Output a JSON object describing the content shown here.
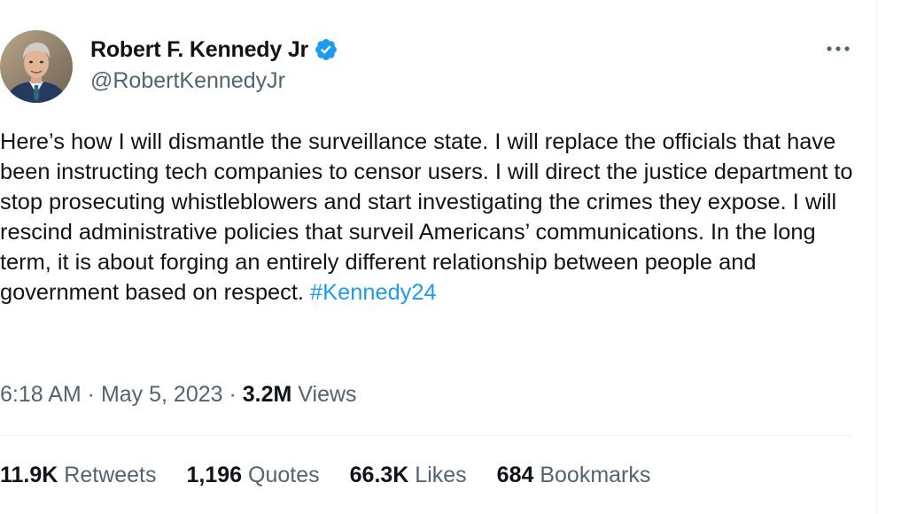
{
  "tweet": {
    "author": {
      "display_name": "Robert F. Kennedy Jr",
      "handle": "@RobertKennedyJr",
      "verified": true,
      "avatar_icon": "profile-photo"
    },
    "body_text": "Here’s how I will dismantle the surveillance state. I will replace the officials that have been instructing tech companies to censor users. I will direct the justice department to stop prosecuting whistleblowers and start investigating the crimes they expose. I will rescind administrative policies that surveil Americans’ communications. In the long term, it is about forging an entirely different relationship between people and government based on respect. ",
    "hashtag": "#Kennedy24",
    "time": "6:18 AM",
    "separator": " · ",
    "date": "May 5, 2023",
    "views_count": "3.2M",
    "views_label": " Views",
    "stats": {
      "retweets_count": "11.9K",
      "retweets_label": " Retweets",
      "quotes_count": "1,196",
      "quotes_label": " Quotes",
      "likes_count": "66.3K",
      "likes_label": " Likes",
      "bookmarks_count": "684",
      "bookmarks_label": " Bookmarks"
    }
  },
  "colors": {
    "text_primary": "#0f1419",
    "text_secondary": "#536471",
    "accent_blue": "#1d9bf0",
    "divider": "#eff3f4"
  },
  "icons": {
    "verified": "verified-badge-icon",
    "more": "more-horizontal-icon"
  }
}
